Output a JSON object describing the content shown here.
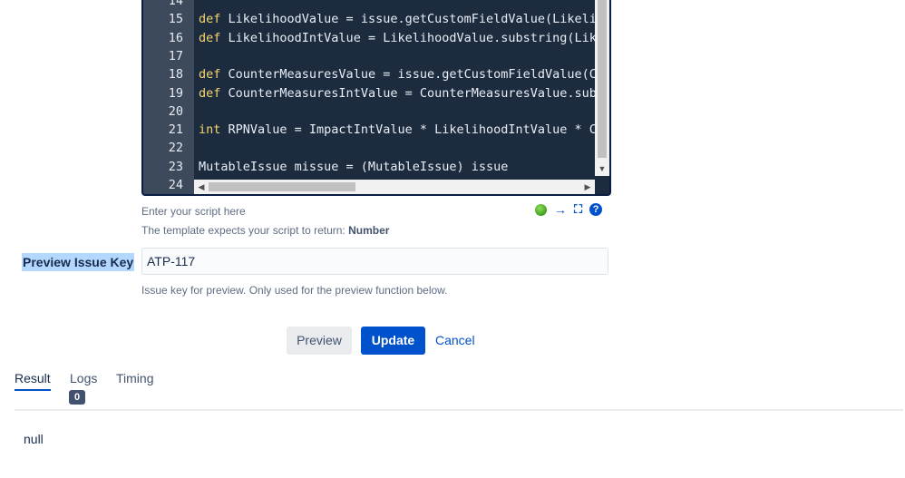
{
  "editor": {
    "lines": [
      {
        "num": "14",
        "keyword": "",
        "code": ""
      },
      {
        "num": "15",
        "keyword": "def",
        "code": " LikelihoodValue = issue.getCustomFieldValue(Likelih"
      },
      {
        "num": "16",
        "keyword": "def",
        "code": " LikelihoodIntValue = LikelihoodValue.substring(Like"
      },
      {
        "num": "17",
        "keyword": "",
        "code": ""
      },
      {
        "num": "18",
        "keyword": "def",
        "code": " CounterMeasuresValue = issue.getCustomFieldValue(Co"
      },
      {
        "num": "19",
        "keyword": "def",
        "code": " CounterMeasuresIntValue = CounterMeasuresValue.subs"
      },
      {
        "num": "20",
        "keyword": "",
        "code": ""
      },
      {
        "num": "21",
        "keyword": "int",
        "code": " RPNValue = ImpactIntValue * LikelihoodIntValue * Co"
      },
      {
        "num": "22",
        "keyword": "",
        "code": ""
      },
      {
        "num": "23",
        "keyword": "",
        "code": "MutableIssue missue = (MutableIssue) issue"
      },
      {
        "num": "24",
        "keyword": "",
        "code": ""
      }
    ],
    "hint": "Enter your script here",
    "return_hint_prefix": "The template expects your script to return: ",
    "return_type": "Number",
    "icons": [
      "status-ok-icon",
      "run-arrow-icon",
      "fullscreen-icon",
      "help-icon"
    ]
  },
  "preview_field": {
    "label": "Preview Issue Key",
    "value": "ATP-117",
    "description": "Issue key for preview. Only used for the preview function below."
  },
  "actions": {
    "preview_label": "Preview",
    "update_label": "Update",
    "cancel_label": "Cancel"
  },
  "tabs": [
    {
      "label": "Result",
      "active": true
    },
    {
      "label": "Logs",
      "badge": "0"
    },
    {
      "label": "Timing"
    }
  ],
  "result": {
    "value": "null"
  },
  "colors": {
    "accent": "#0052cc",
    "editor_bg": "#1d2b3f",
    "keyword": "#f5d76e",
    "selection": "#b4d7ff"
  }
}
